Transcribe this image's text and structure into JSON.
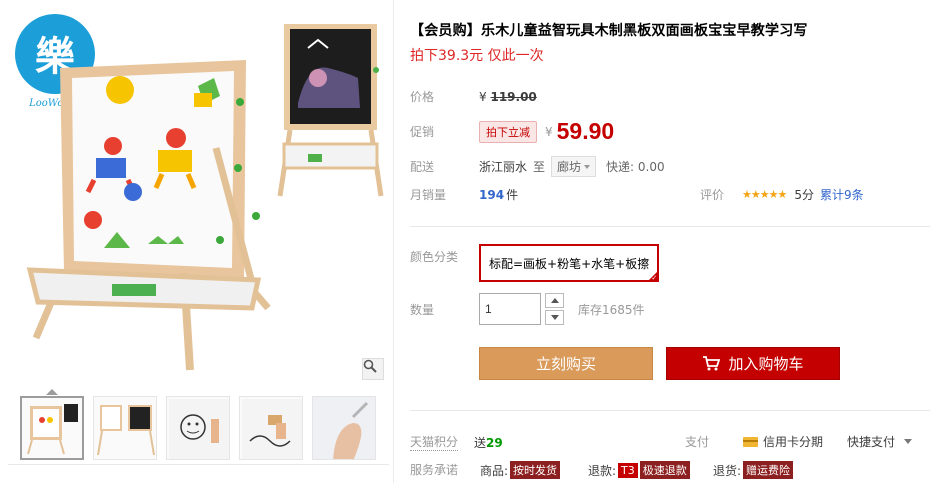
{
  "product": {
    "title": "【会员购】乐木儿童益智玩具木制黑板双面画板宝宝早教学习写",
    "subtitle": "拍下39.3元 仅此一次"
  },
  "gallery": {
    "brand_logo_text": "樂木",
    "thumbnails": [
      {
        "name": "thumb-1",
        "icon": "easel-front"
      },
      {
        "name": "thumb-2",
        "icon": "easel-pair"
      },
      {
        "name": "thumb-3",
        "icon": "whiteboard-drawing"
      },
      {
        "name": "thumb-4",
        "icon": "whiteboard-eraser"
      },
      {
        "name": "thumb-5",
        "icon": "hand-closeup"
      }
    ],
    "zoom_icon": "magnifier-icon"
  },
  "price": {
    "label": "价格",
    "currency": "¥",
    "original": "119.00",
    "promo_label": "促销",
    "promo_tag": "拍下立减",
    "current": "59.90"
  },
  "shipping": {
    "label": "配送",
    "from": "浙江丽水",
    "to_text": "至",
    "destination": "廊坊",
    "fee": "快递: 0.00"
  },
  "sales": {
    "label": "月销量",
    "count": "194",
    "unit": "件",
    "rating_label": "评价",
    "stars": "★★★★★",
    "score": "5分",
    "reviews": "累计9条"
  },
  "sku": {
    "label": "颜色分类",
    "selected": "标配=画板+粉笔+水笔+板擦"
  },
  "quantity": {
    "label": "数量",
    "value": "1",
    "stock": "库存1685件"
  },
  "actions": {
    "buy_now": "立刻购买",
    "add_to_cart": "加入购物车"
  },
  "extras": {
    "points_label": "天猫积分",
    "points_prefix": "送",
    "points_value": "29",
    "pay_label": "支付",
    "pay_card": "信用卡分期",
    "pay_quick": "快捷支付",
    "service_label": "服务承诺",
    "services": [
      {
        "prefix": "商品:",
        "badge": "按时发货"
      },
      {
        "prefix": "退款:",
        "badge": "T3",
        "text": "极速退款"
      },
      {
        "prefix": "退货:",
        "badge": "赠运费险"
      }
    ]
  },
  "colors": {
    "accent_red": "#c40000",
    "buy_orange": "#d99a5a",
    "link_blue": "#3366cc",
    "logo_blue": "#1c9ed8"
  }
}
